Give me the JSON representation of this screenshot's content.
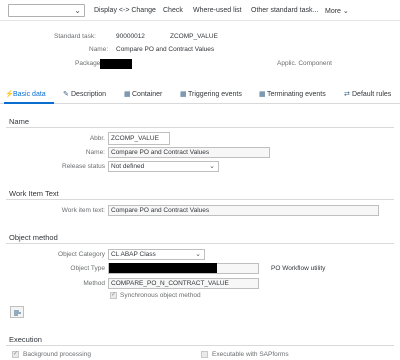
{
  "toolbar": {
    "command_field_value": "",
    "items": [
      "Display <-> Change",
      "Check",
      "Where-used list",
      "Other standard task...",
      "More"
    ]
  },
  "header": {
    "standard_task_label": "Standard task:",
    "standard_task_id": "90000012",
    "standard_task_name": "ZCOMP_VALUE",
    "name_label": "Name:",
    "name_value": "Compare PO and Contract Values",
    "package_label": "Package:",
    "applic_label": "Applic. Component"
  },
  "tabs": [
    {
      "label": "Basic data",
      "icon": "lightning-icon",
      "active": true
    },
    {
      "label": "Description",
      "icon": "edit-icon"
    },
    {
      "label": "Container",
      "icon": "container-icon"
    },
    {
      "label": "Triggering events",
      "icon": "triggering-event-icon"
    },
    {
      "label": "Terminating events",
      "icon": "terminating-event-icon"
    },
    {
      "label": "Default rules",
      "icon": "rules-icon"
    }
  ],
  "name_section": {
    "title": "Name",
    "abbr_label": "Abbr.",
    "abbr_value": "ZCOMP_VALUE",
    "name_label": "Name:",
    "name_value": "Compare PO and Contract Values",
    "release_label": "Release status",
    "release_value": "Not defined"
  },
  "work_item_section": {
    "title": "Work Item Text",
    "label": "Work item text:",
    "value": "Compare PO and Contract Values"
  },
  "object_method_section": {
    "title": "Object method",
    "category_label": "Object Category",
    "category_value": "CL ABAP Class",
    "type_label": "Object Type",
    "type_description": "PO Workflow utility",
    "method_label": "Method",
    "method_value": "COMPARE_PO_N_CONTRACT_VALUE",
    "sync_label": "Synchronous object method",
    "sync_checked": true
  },
  "execution_section": {
    "title": "Execution",
    "background_label": "Background processing",
    "background_checked": true,
    "sapforms_label": "Executable with SAPforms",
    "sapforms_checked": false
  },
  "colors": {
    "accent": "#0a6ed1",
    "redaction": "#000000"
  }
}
